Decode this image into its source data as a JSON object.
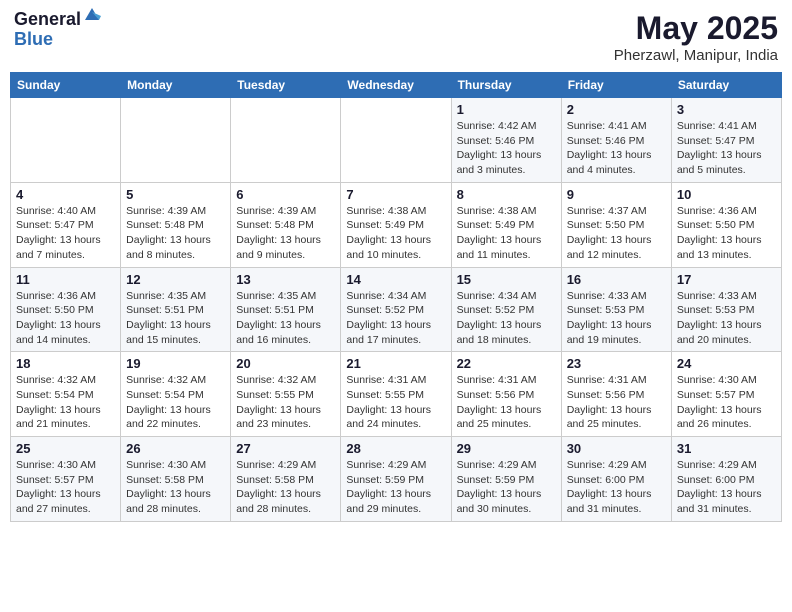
{
  "header": {
    "logo_general": "General",
    "logo_blue": "Blue",
    "month": "May 2025",
    "location": "Pherzawl, Manipur, India"
  },
  "weekdays": [
    "Sunday",
    "Monday",
    "Tuesday",
    "Wednesday",
    "Thursday",
    "Friday",
    "Saturday"
  ],
  "weeks": [
    [
      {
        "day": "",
        "info": ""
      },
      {
        "day": "",
        "info": ""
      },
      {
        "day": "",
        "info": ""
      },
      {
        "day": "",
        "info": ""
      },
      {
        "day": "1",
        "info": "Sunrise: 4:42 AM\nSunset: 5:46 PM\nDaylight: 13 hours\nand 3 minutes."
      },
      {
        "day": "2",
        "info": "Sunrise: 4:41 AM\nSunset: 5:46 PM\nDaylight: 13 hours\nand 4 minutes."
      },
      {
        "day": "3",
        "info": "Sunrise: 4:41 AM\nSunset: 5:47 PM\nDaylight: 13 hours\nand 5 minutes."
      }
    ],
    [
      {
        "day": "4",
        "info": "Sunrise: 4:40 AM\nSunset: 5:47 PM\nDaylight: 13 hours\nand 7 minutes."
      },
      {
        "day": "5",
        "info": "Sunrise: 4:39 AM\nSunset: 5:48 PM\nDaylight: 13 hours\nand 8 minutes."
      },
      {
        "day": "6",
        "info": "Sunrise: 4:39 AM\nSunset: 5:48 PM\nDaylight: 13 hours\nand 9 minutes."
      },
      {
        "day": "7",
        "info": "Sunrise: 4:38 AM\nSunset: 5:49 PM\nDaylight: 13 hours\nand 10 minutes."
      },
      {
        "day": "8",
        "info": "Sunrise: 4:38 AM\nSunset: 5:49 PM\nDaylight: 13 hours\nand 11 minutes."
      },
      {
        "day": "9",
        "info": "Sunrise: 4:37 AM\nSunset: 5:50 PM\nDaylight: 13 hours\nand 12 minutes."
      },
      {
        "day": "10",
        "info": "Sunrise: 4:36 AM\nSunset: 5:50 PM\nDaylight: 13 hours\nand 13 minutes."
      }
    ],
    [
      {
        "day": "11",
        "info": "Sunrise: 4:36 AM\nSunset: 5:50 PM\nDaylight: 13 hours\nand 14 minutes."
      },
      {
        "day": "12",
        "info": "Sunrise: 4:35 AM\nSunset: 5:51 PM\nDaylight: 13 hours\nand 15 minutes."
      },
      {
        "day": "13",
        "info": "Sunrise: 4:35 AM\nSunset: 5:51 PM\nDaylight: 13 hours\nand 16 minutes."
      },
      {
        "day": "14",
        "info": "Sunrise: 4:34 AM\nSunset: 5:52 PM\nDaylight: 13 hours\nand 17 minutes."
      },
      {
        "day": "15",
        "info": "Sunrise: 4:34 AM\nSunset: 5:52 PM\nDaylight: 13 hours\nand 18 minutes."
      },
      {
        "day": "16",
        "info": "Sunrise: 4:33 AM\nSunset: 5:53 PM\nDaylight: 13 hours\nand 19 minutes."
      },
      {
        "day": "17",
        "info": "Sunrise: 4:33 AM\nSunset: 5:53 PM\nDaylight: 13 hours\nand 20 minutes."
      }
    ],
    [
      {
        "day": "18",
        "info": "Sunrise: 4:32 AM\nSunset: 5:54 PM\nDaylight: 13 hours\nand 21 minutes."
      },
      {
        "day": "19",
        "info": "Sunrise: 4:32 AM\nSunset: 5:54 PM\nDaylight: 13 hours\nand 22 minutes."
      },
      {
        "day": "20",
        "info": "Sunrise: 4:32 AM\nSunset: 5:55 PM\nDaylight: 13 hours\nand 23 minutes."
      },
      {
        "day": "21",
        "info": "Sunrise: 4:31 AM\nSunset: 5:55 PM\nDaylight: 13 hours\nand 24 minutes."
      },
      {
        "day": "22",
        "info": "Sunrise: 4:31 AM\nSunset: 5:56 PM\nDaylight: 13 hours\nand 25 minutes."
      },
      {
        "day": "23",
        "info": "Sunrise: 4:31 AM\nSunset: 5:56 PM\nDaylight: 13 hours\nand 25 minutes."
      },
      {
        "day": "24",
        "info": "Sunrise: 4:30 AM\nSunset: 5:57 PM\nDaylight: 13 hours\nand 26 minutes."
      }
    ],
    [
      {
        "day": "25",
        "info": "Sunrise: 4:30 AM\nSunset: 5:57 PM\nDaylight: 13 hours\nand 27 minutes."
      },
      {
        "day": "26",
        "info": "Sunrise: 4:30 AM\nSunset: 5:58 PM\nDaylight: 13 hours\nand 28 minutes."
      },
      {
        "day": "27",
        "info": "Sunrise: 4:29 AM\nSunset: 5:58 PM\nDaylight: 13 hours\nand 28 minutes."
      },
      {
        "day": "28",
        "info": "Sunrise: 4:29 AM\nSunset: 5:59 PM\nDaylight: 13 hours\nand 29 minutes."
      },
      {
        "day": "29",
        "info": "Sunrise: 4:29 AM\nSunset: 5:59 PM\nDaylight: 13 hours\nand 30 minutes."
      },
      {
        "day": "30",
        "info": "Sunrise: 4:29 AM\nSunset: 6:00 PM\nDaylight: 13 hours\nand 31 minutes."
      },
      {
        "day": "31",
        "info": "Sunrise: 4:29 AM\nSunset: 6:00 PM\nDaylight: 13 hours\nand 31 minutes."
      }
    ]
  ]
}
